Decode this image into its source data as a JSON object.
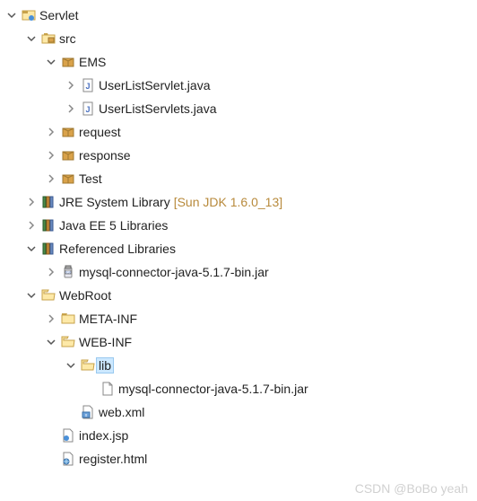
{
  "project": {
    "name": "Servlet",
    "src": {
      "label": "src",
      "packages": {
        "ems": {
          "label": "EMS",
          "files": [
            "UserListServlet.java",
            "UserListServlets.java"
          ]
        },
        "request": "request",
        "response": "response",
        "test": "Test"
      }
    },
    "jre": {
      "label": "JRE System Library",
      "decoration": "[Sun JDK 1.6.0_13]"
    },
    "javaee": "Java EE 5 Libraries",
    "reflib": {
      "label": "Referenced Libraries",
      "jars": [
        "mysql-connector-java-5.1.7-bin.jar"
      ]
    },
    "webroot": {
      "label": "WebRoot",
      "metainf": "META-INF",
      "webinf": {
        "label": "WEB-INF",
        "lib": {
          "label": "lib",
          "files": [
            "mysql-connector-java-5.1.7-bin.jar"
          ]
        },
        "webxml": "web.xml"
      },
      "files": {
        "index": "index.jsp",
        "register": "register.html"
      }
    }
  },
  "watermark": "CSDN @BoBo yeah"
}
